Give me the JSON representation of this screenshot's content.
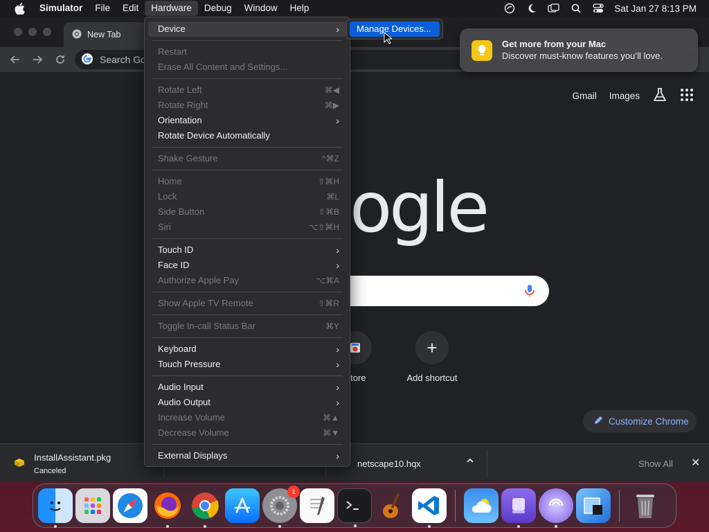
{
  "menubar": {
    "app_name": "Simulator",
    "items": [
      "File",
      "Edit",
      "Hardware",
      "Debug",
      "Window",
      "Help"
    ],
    "clock": "Sat Jan 27  8:13 PM"
  },
  "browser": {
    "tab_title": "New Tab",
    "omnibox_placeholder": "Search Go",
    "top_links": {
      "gmail": "Gmail",
      "images": "Images"
    },
    "logo_fragment": "ogle",
    "shortcuts": [
      {
        "label": "Store"
      },
      {
        "label": "Add shortcut",
        "glyph": "+"
      }
    ],
    "customize_label": "Customize Chrome"
  },
  "downloads": {
    "item1_name": "InstallAssistant.pkg",
    "item1_status": "Canceled",
    "item2_name": "netscape10.hqx",
    "show_all": "Show All",
    "close": "✕"
  },
  "notification": {
    "title": "Get more from your Mac",
    "body": "Discover must-know features you’ll love."
  },
  "hardware_menu": {
    "device": "Device",
    "restart": "Restart",
    "erase": "Erase All Content and Settings...",
    "rotate_left": "Rotate Left",
    "rotate_left_sc": "⌘◀",
    "rotate_right": "Rotate Right",
    "rotate_right_sc": "⌘▶",
    "orientation": "Orientation",
    "rotate_auto": "Rotate Device Automatically",
    "shake": "Shake Gesture",
    "shake_sc": "^⌘Z",
    "home": "Home",
    "home_sc": "⇧⌘H",
    "lock": "Lock",
    "lock_sc": "⌘L",
    "side_button": "Side Button",
    "side_button_sc": "⇧⌘B",
    "siri": "Siri",
    "siri_sc": "⌥⇧⌘H",
    "touch_id": "Touch ID",
    "face_id": "Face ID",
    "apple_pay": "Authorize Apple Pay",
    "apple_pay_sc": "⌥⌘A",
    "tv_remote": "Show Apple TV Remote",
    "tv_remote_sc": "⇧⌘R",
    "in_call": "Toggle In-call Status Bar",
    "in_call_sc": "⌘Y",
    "keyboard": "Keyboard",
    "touch_pressure": "Touch Pressure",
    "audio_input": "Audio Input",
    "audio_output": "Audio Output",
    "vol_up": "Increase Volume",
    "vol_up_sc": "⌘▲",
    "vol_down": "Decrease Volume",
    "vol_down_sc": "⌘▼",
    "external_displays": "External Displays",
    "arrow": "›"
  },
  "submenu": {
    "manage_devices": "Manage Devices..."
  },
  "dock": {
    "settings_badge": "1",
    "apps": [
      "finder-icon",
      "launchpad-icon",
      "safari-icon",
      "firefox-icon",
      "chrome-icon",
      "app-store-icon",
      "system-settings-icon",
      "textedit-icon",
      "terminal-icon",
      "garageband-icon",
      "vscode-icon",
      "weather-icon",
      "storage-icon",
      "torrent-icon",
      "preview-icon",
      "trash-icon"
    ]
  }
}
